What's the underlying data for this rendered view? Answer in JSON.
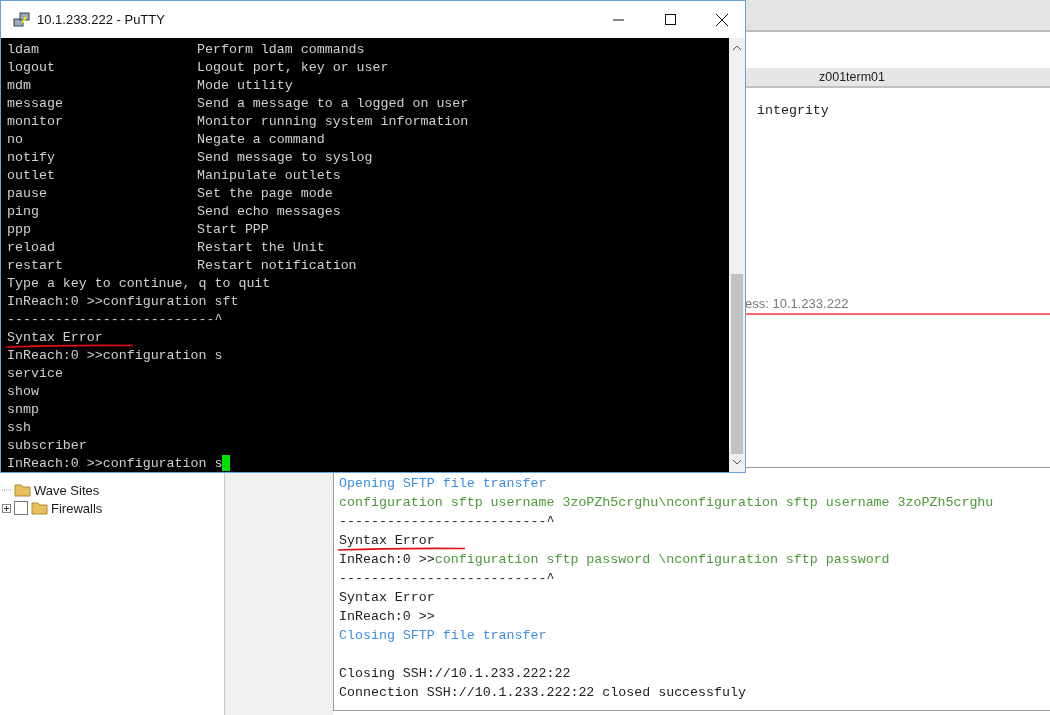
{
  "background_app": {
    "session_tab": "z001term01",
    "upper_pane_line": "integrity",
    "address_line": "ess: 10.1.233.222",
    "tree": [
      {
        "kind": "folder",
        "label": "Wave Sites"
      },
      {
        "kind": "checkbox",
        "label": "Firewalls",
        "checked": false
      }
    ],
    "log": [
      {
        "kind": "info",
        "text": "Opening SFTP file transfer"
      },
      {
        "kind": "command",
        "text": "configuration sftp username 3zoPZh5crghu\\nconfiguration sftp username 3zoPZh5crghu"
      },
      {
        "kind": "plain",
        "text": "--------------------------^"
      },
      {
        "kind": "plain",
        "text": "Syntax Error",
        "underlined": true
      },
      {
        "kind": "command",
        "prompt": "InReach:0 >>",
        "text": "configuration sftp password \\nconfiguration sftp password"
      },
      {
        "kind": "plain",
        "text": "--------------------------^"
      },
      {
        "kind": "plain",
        "text": "Syntax Error"
      },
      {
        "kind": "plain",
        "text": "InReach:0 >>"
      },
      {
        "kind": "info",
        "text": "Closing SFTP file transfer"
      },
      {
        "kind": "blank"
      },
      {
        "kind": "plain",
        "text": "Closing SSH://10.1.233.222:22"
      },
      {
        "kind": "plain",
        "text": "Connection SSH://10.1.233.222:22 closed successfuly"
      }
    ]
  },
  "putty": {
    "title": "10.1.233.222 - PuTTY",
    "lines": [
      {
        "kind": "help",
        "command": "ldam",
        "description": "Perform ldam commands"
      },
      {
        "kind": "help",
        "command": "logout",
        "description": "Logout port, key or user"
      },
      {
        "kind": "help",
        "command": "mdm",
        "description": "Mode utility"
      },
      {
        "kind": "help",
        "command": "message",
        "description": "Send a message to a logged on user"
      },
      {
        "kind": "help",
        "command": "monitor",
        "description": "Monitor running system information"
      },
      {
        "kind": "help",
        "command": "no",
        "description": "Negate a command"
      },
      {
        "kind": "help",
        "command": "notify",
        "description": "Send message to syslog"
      },
      {
        "kind": "help",
        "command": "outlet",
        "description": "Manipulate outlets"
      },
      {
        "kind": "help",
        "command": "pause",
        "description": "Set the page mode"
      },
      {
        "kind": "help",
        "command": "ping",
        "description": "Send echo messages"
      },
      {
        "kind": "help",
        "command": "ppp",
        "description": "Start PPP"
      },
      {
        "kind": "help",
        "command": "reload",
        "description": "Restart the Unit"
      },
      {
        "kind": "help",
        "command": "restart",
        "description": "Restart notification"
      },
      {
        "kind": "plain",
        "text": "Type a key to continue, q to quit"
      },
      {
        "kind": "plain",
        "text": "InReach:0 >>configuration sft"
      },
      {
        "kind": "plain",
        "text": "--------------------------^"
      },
      {
        "kind": "plain",
        "text": "Syntax Error",
        "underlined": true
      },
      {
        "kind": "plain",
        "text": "InReach:0 >>configuration s"
      },
      {
        "kind": "plain",
        "text": "service"
      },
      {
        "kind": "plain",
        "text": "show"
      },
      {
        "kind": "plain",
        "text": "snmp"
      },
      {
        "kind": "plain",
        "text": "ssh"
      },
      {
        "kind": "plain",
        "text": "subscriber"
      },
      {
        "kind": "plain",
        "text": "InReach:0 >>configuration s",
        "cursor": true
      }
    ]
  }
}
